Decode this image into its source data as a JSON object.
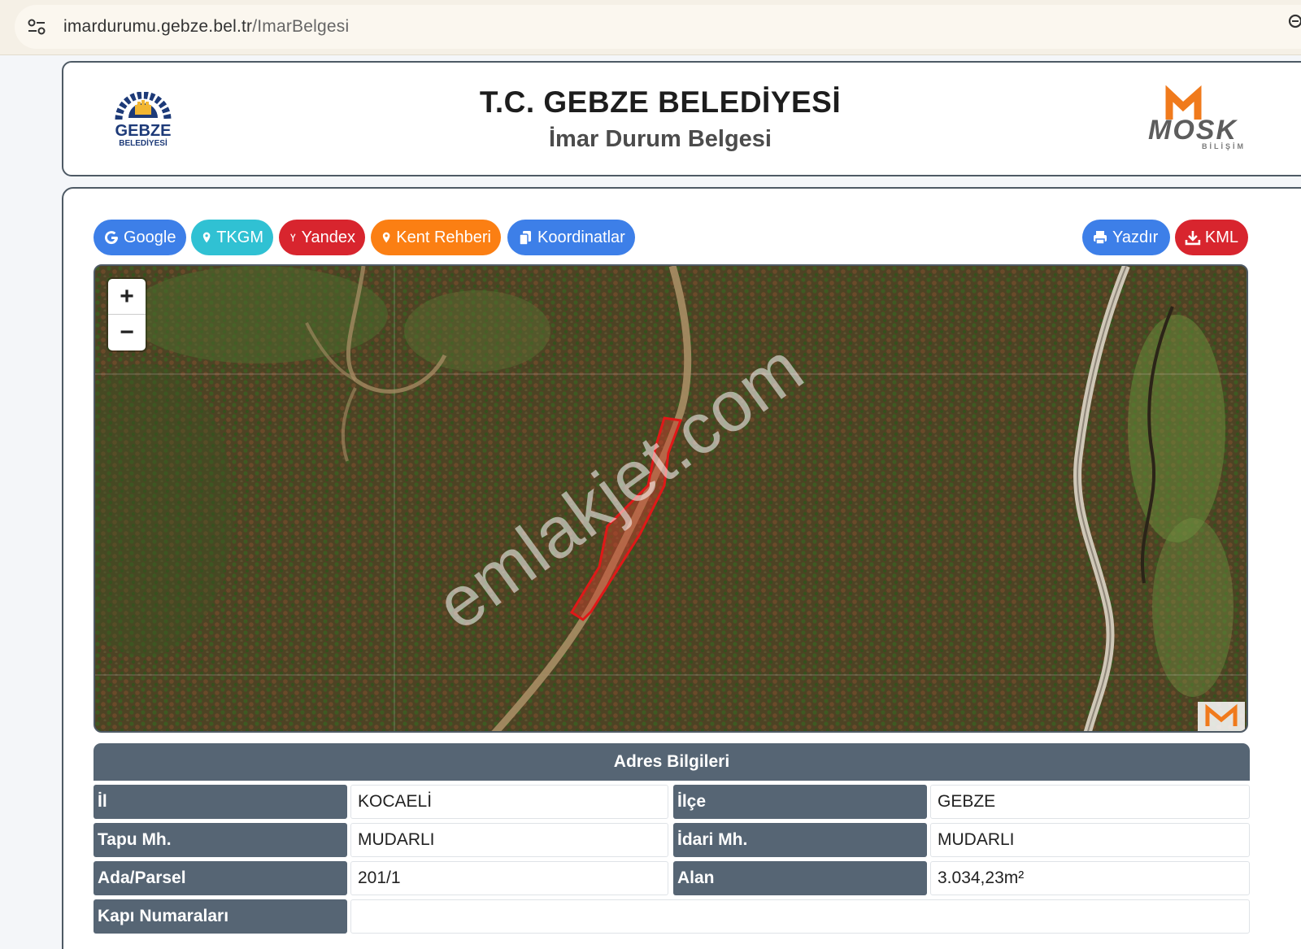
{
  "browser": {
    "url_host": "imardurumu.gebze.bel.tr",
    "url_path": "/ImarBelgesi",
    "site_info_icon": "tune-icon",
    "zoom_icon": "magnifier-icon"
  },
  "header": {
    "title": "T.C. GEBZE BELEDİYESİ",
    "subtitle": "İmar Durum Belgesi",
    "left_logo": {
      "line1": "GEBZE",
      "line2": "BELEDİYESİ"
    },
    "right_logo": {
      "line1": "MOSK",
      "line2": "BİLİŞİM"
    }
  },
  "toolbar": {
    "buttons": [
      {
        "label": "Google",
        "icon": "google-icon",
        "color": "#3d7fe8"
      },
      {
        "label": "TKGM",
        "icon": "map-pin-icon",
        "color": "#30c1d3"
      },
      {
        "label": "Yandex",
        "icon": "yandex-icon",
        "color": "#d8252e"
      },
      {
        "label": "Kent Rehberi",
        "icon": "map-pin-icon",
        "color": "#fb7f13"
      },
      {
        "label": "Koordinatlar",
        "icon": "copy-icon",
        "color": "#3d7fe8"
      }
    ],
    "right_buttons": [
      {
        "label": "Yazdır",
        "icon": "printer-icon",
        "color": "#3d7fe8"
      },
      {
        "label": "KML",
        "icon": "download-icon",
        "color": "#d8252e"
      }
    ]
  },
  "map": {
    "zoom_in": "+",
    "zoom_out": "−",
    "watermark": "emlakjet.com",
    "parcel_color": "#e01818"
  },
  "address": {
    "title": "Adres Bilgileri",
    "rows": [
      {
        "label1": "İl",
        "value1": "KOCAELİ",
        "label2": "İlçe",
        "value2": "GEBZE"
      },
      {
        "label1": "Tapu Mh.",
        "value1": "MUDARLI",
        "label2": "İdari Mh.",
        "value2": "MUDARLI"
      },
      {
        "label1": "Ada/Parsel",
        "value1": "201/1",
        "label2": "Alan",
        "value2": "3.034,23m²"
      },
      {
        "label1": "Kapı Numaraları",
        "value1": ""
      }
    ]
  }
}
